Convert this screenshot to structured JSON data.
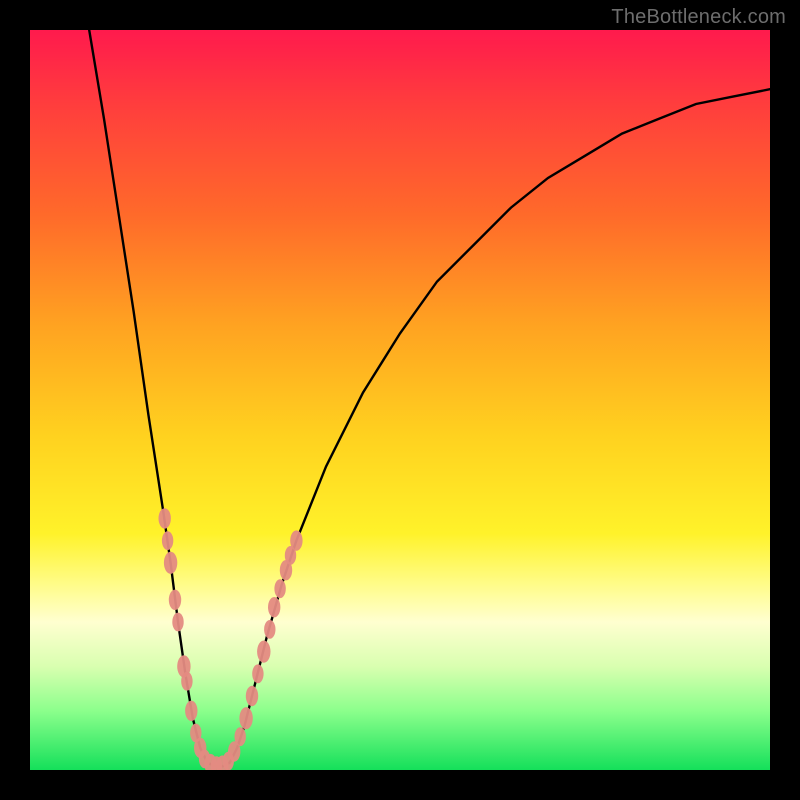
{
  "watermark": "TheBottleneck.com",
  "colors": {
    "frame": "#000000",
    "curve": "#000000",
    "marker": "#e48b82",
    "gradient_stops": [
      {
        "pos": 0.0,
        "color": "#ff1a4d"
      },
      {
        "pos": 0.1,
        "color": "#ff3d3d"
      },
      {
        "pos": 0.25,
        "color": "#ff6a2a"
      },
      {
        "pos": 0.4,
        "color": "#ffa321"
      },
      {
        "pos": 0.55,
        "color": "#ffd21f"
      },
      {
        "pos": 0.68,
        "color": "#fff22a"
      },
      {
        "pos": 0.75,
        "color": "#fffc8a"
      },
      {
        "pos": 0.8,
        "color": "#ffffd0"
      },
      {
        "pos": 0.86,
        "color": "#d9ffb0"
      },
      {
        "pos": 0.92,
        "color": "#8cff8c"
      },
      {
        "pos": 1.0,
        "color": "#14e05a"
      }
    ]
  },
  "chart_data": {
    "type": "line",
    "title": "",
    "xlabel": "",
    "ylabel": "",
    "xlim": [
      0,
      100
    ],
    "ylim": [
      0,
      100
    ],
    "description": "V-shaped bottleneck curve on rainbow gradient. Left branch descends steeply from top-left to a minimum near x≈25, right branch rises with decreasing slope toward top-right. Salmon-colored markers cluster around the valley on both branches.",
    "series": [
      {
        "name": "bottleneck-curve",
        "points": [
          {
            "x": 8,
            "y": 100
          },
          {
            "x": 10,
            "y": 88
          },
          {
            "x": 12,
            "y": 75
          },
          {
            "x": 14,
            "y": 62
          },
          {
            "x": 16,
            "y": 48
          },
          {
            "x": 18,
            "y": 35
          },
          {
            "x": 19,
            "y": 28
          },
          {
            "x": 20,
            "y": 20
          },
          {
            "x": 21,
            "y": 13
          },
          {
            "x": 22,
            "y": 7
          },
          {
            "x": 23,
            "y": 3
          },
          {
            "x": 24,
            "y": 1
          },
          {
            "x": 25,
            "y": 0.5
          },
          {
            "x": 26,
            "y": 0.5
          },
          {
            "x": 27,
            "y": 1
          },
          {
            "x": 28,
            "y": 3
          },
          {
            "x": 29,
            "y": 6
          },
          {
            "x": 30,
            "y": 10
          },
          {
            "x": 32,
            "y": 18
          },
          {
            "x": 34,
            "y": 25
          },
          {
            "x": 36,
            "y": 31
          },
          {
            "x": 40,
            "y": 41
          },
          {
            "x": 45,
            "y": 51
          },
          {
            "x": 50,
            "y": 59
          },
          {
            "x": 55,
            "y": 66
          },
          {
            "x": 60,
            "y": 71
          },
          {
            "x": 65,
            "y": 76
          },
          {
            "x": 70,
            "y": 80
          },
          {
            "x": 75,
            "y": 83
          },
          {
            "x": 80,
            "y": 86
          },
          {
            "x": 85,
            "y": 88
          },
          {
            "x": 90,
            "y": 90
          },
          {
            "x": 95,
            "y": 91
          },
          {
            "x": 100,
            "y": 92
          }
        ]
      }
    ],
    "markers": [
      {
        "x": 18.2,
        "y": 34,
        "r": 1.2
      },
      {
        "x": 18.6,
        "y": 31,
        "r": 1.1
      },
      {
        "x": 19.0,
        "y": 28,
        "r": 1.3
      },
      {
        "x": 19.6,
        "y": 23,
        "r": 1.2
      },
      {
        "x": 20.0,
        "y": 20,
        "r": 1.1
      },
      {
        "x": 20.8,
        "y": 14,
        "r": 1.3
      },
      {
        "x": 21.2,
        "y": 12,
        "r": 1.1
      },
      {
        "x": 21.8,
        "y": 8,
        "r": 1.2
      },
      {
        "x": 22.4,
        "y": 5,
        "r": 1.1
      },
      {
        "x": 23.0,
        "y": 3,
        "r": 1.2
      },
      {
        "x": 23.6,
        "y": 1.5,
        "r": 1.1
      },
      {
        "x": 24.4,
        "y": 0.8,
        "r": 1.2
      },
      {
        "x": 25.2,
        "y": 0.6,
        "r": 1.1
      },
      {
        "x": 26.0,
        "y": 0.6,
        "r": 1.2
      },
      {
        "x": 26.8,
        "y": 1.2,
        "r": 1.1
      },
      {
        "x": 27.6,
        "y": 2.5,
        "r": 1.2
      },
      {
        "x": 28.4,
        "y": 4.5,
        "r": 1.1
      },
      {
        "x": 29.2,
        "y": 7,
        "r": 1.3
      },
      {
        "x": 30.0,
        "y": 10,
        "r": 1.2
      },
      {
        "x": 30.8,
        "y": 13,
        "r": 1.1
      },
      {
        "x": 31.6,
        "y": 16,
        "r": 1.3
      },
      {
        "x": 32.4,
        "y": 19,
        "r": 1.1
      },
      {
        "x": 33.0,
        "y": 22,
        "r": 1.2
      },
      {
        "x": 33.8,
        "y": 24.5,
        "r": 1.1
      },
      {
        "x": 34.6,
        "y": 27,
        "r": 1.2
      },
      {
        "x": 35.2,
        "y": 29,
        "r": 1.1
      },
      {
        "x": 36.0,
        "y": 31,
        "r": 1.2
      }
    ]
  }
}
